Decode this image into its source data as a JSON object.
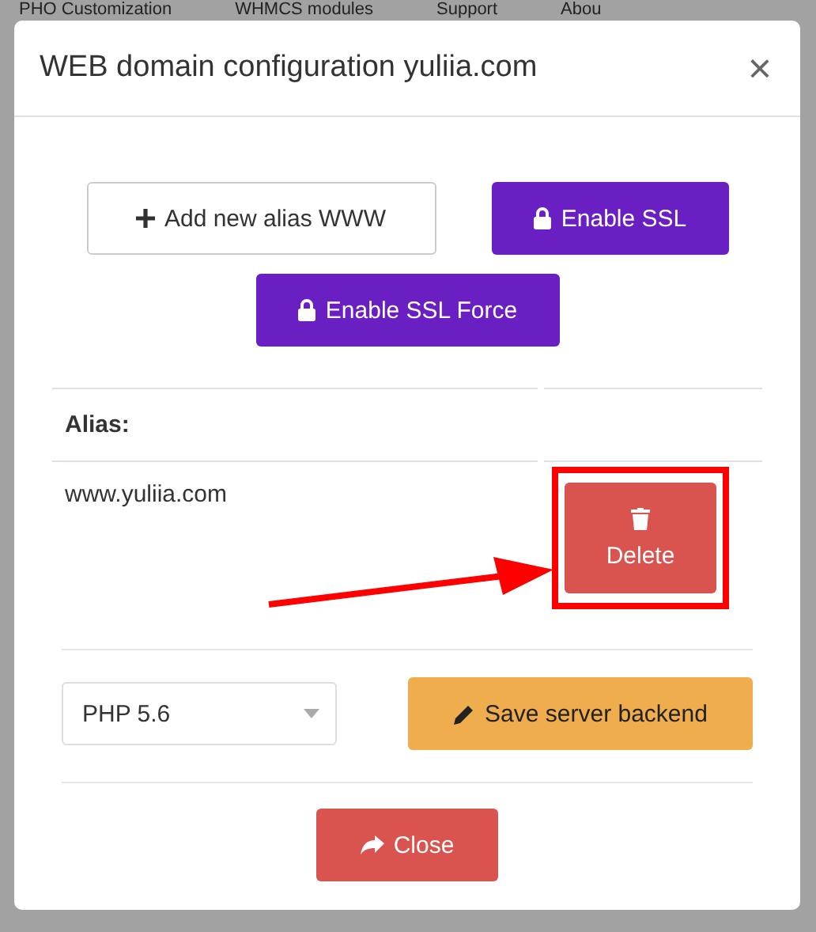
{
  "background_nav": [
    "PHO Customization",
    "WHMCS modules",
    "Support",
    "Abou"
  ],
  "modal": {
    "title": "WEB domain configuration yuliia.com",
    "close_symbol": "×",
    "actions": [
      {
        "label": "Add new alias WWW",
        "kind": "add"
      },
      {
        "label": "Enable SSL",
        "kind": "lock"
      },
      {
        "label": "Enable SSL Force",
        "kind": "lock"
      }
    ],
    "table": {
      "columns": [
        "Alias:"
      ],
      "rows": [
        {
          "alias": "www.yuliia.com",
          "action": "Delete"
        }
      ]
    },
    "php_select": {
      "value": "PHP 5.6"
    },
    "save_button": "Save server backend",
    "close_button": "Close"
  }
}
